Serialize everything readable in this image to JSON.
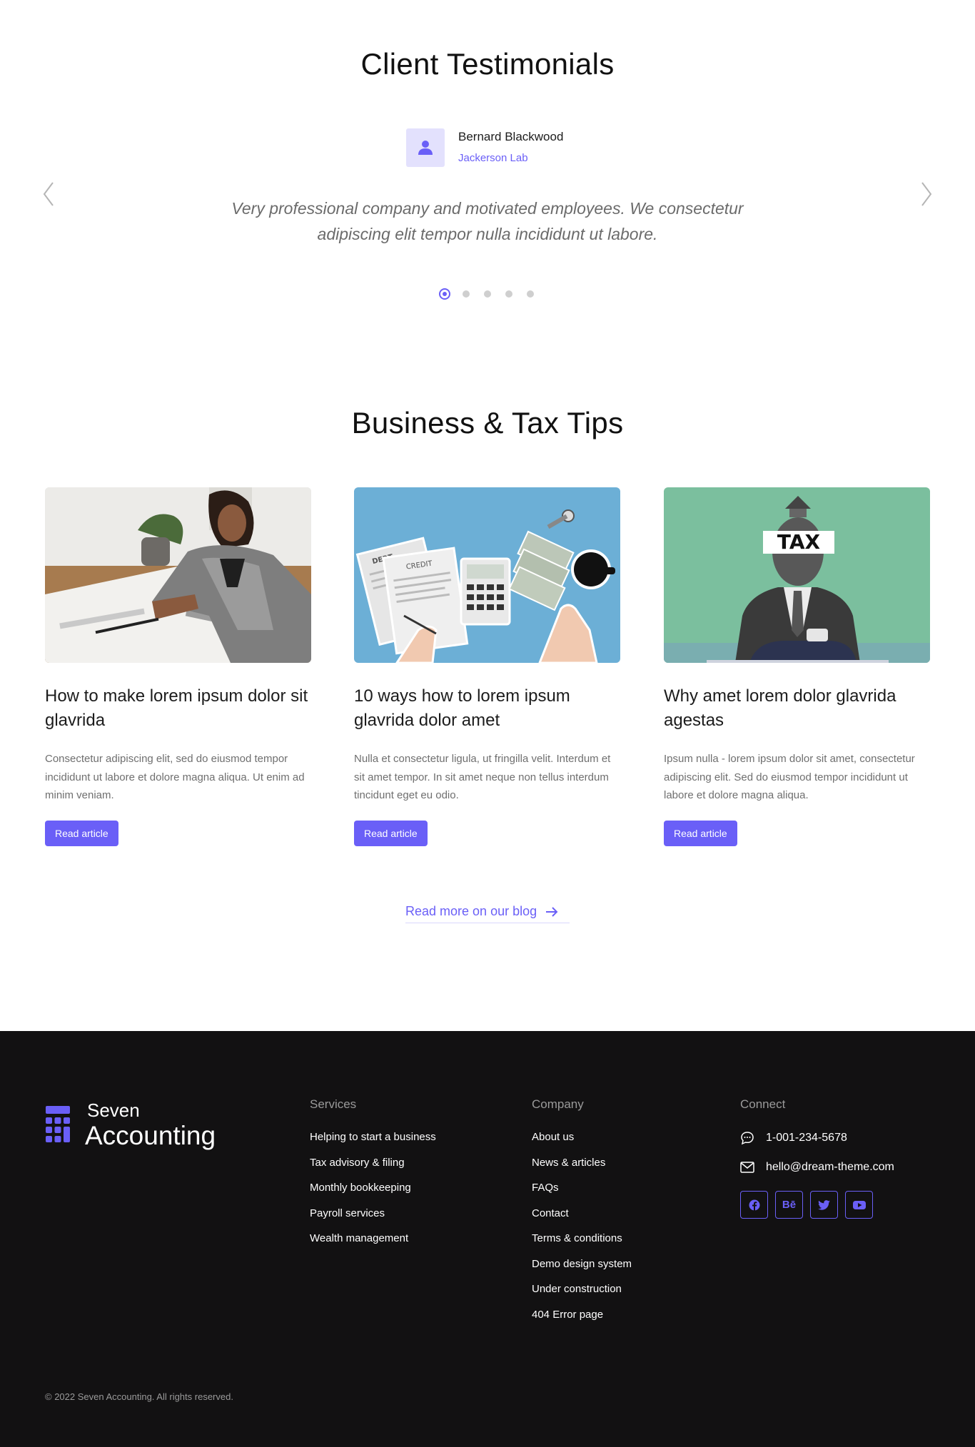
{
  "testimonials": {
    "title": "Client Testimonials",
    "name": "Bernard Blackwood",
    "company": "Jackerson Lab",
    "quote": "Very professional company and motivated employees. We consectetur adipiscing elit tempor nulla incididunt ut labore.",
    "slide_count": 5,
    "active_slide": 1
  },
  "blog": {
    "title": "Business & Tax Tips",
    "posts": [
      {
        "title": "How to make lorem ipsum dolor sit glavrida",
        "excerpt": "Consectetur adipiscing elit, sed do eiusmod tempor incididunt ut labore et dolore magna aliqua. Ut enim ad minim veniam.",
        "button": "Read article"
      },
      {
        "title": "10 ways how to lorem ipsum glavrida dolor amet",
        "excerpt": "Nulla et consectetur ligula, ut fringilla velit. Interdum et sit amet tempor. In sit amet neque non tellus interdum tincidunt eget eu odio.",
        "button": "Read article",
        "image_labels": {
          "debt": "DEBT",
          "credit": "CREDIT"
        }
      },
      {
        "title": "Why amet lorem dolor glavrida agestas",
        "excerpt": "Ipsum nulla - lorem ipsum dolor sit amet, consectetur adipiscing elit. Sed do eiusmod tempor incididunt ut labore et dolore magna aliqua.",
        "button": "Read article",
        "image_label": "TAX"
      }
    ],
    "more_link": "Read more on our blog"
  },
  "footer": {
    "logo": {
      "line1": "Seven",
      "line2": "Accounting"
    },
    "services": {
      "title": "Services",
      "links": [
        "Helping to start a business",
        "Tax advisory & filing",
        "Monthly bookkeeping",
        "Payroll services",
        "Wealth management"
      ]
    },
    "company": {
      "title": "Company",
      "links": [
        "About us",
        "News & articles",
        "FAQs",
        "Contact",
        "Terms & conditions",
        "Demo design system",
        "Under construction",
        "404 Error page"
      ]
    },
    "connect": {
      "title": "Connect",
      "phone": "1-001-234-5678",
      "email": "hello@dream-theme.com",
      "socials": [
        "facebook-icon",
        "behance-icon",
        "twitter-icon",
        "youtube-icon"
      ],
      "behance_label": "Bē"
    },
    "copyright": "© 2022 Seven Accounting. All rights reserved."
  },
  "colors": {
    "accent": "#6a5ff7",
    "footer_bg": "#121112",
    "avatar_bg": "#e3e1fd"
  }
}
